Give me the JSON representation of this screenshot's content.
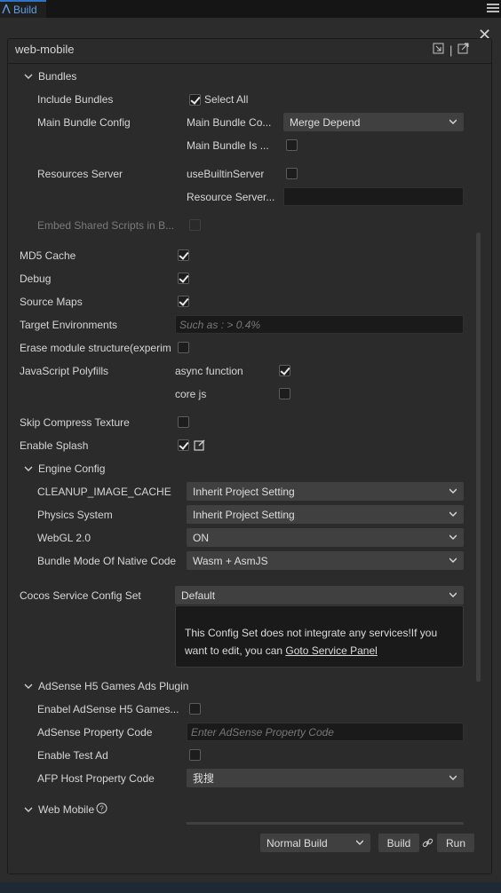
{
  "tab": {
    "label": "Build"
  },
  "panel": {
    "title": "web-mobile",
    "header_separator": "|"
  },
  "bundles": {
    "section_label": "Bundles",
    "include_bundles_label": "Include Bundles",
    "select_all_label": "Select All",
    "select_all_checked": true,
    "main_bundle_config_label": "Main Bundle Config",
    "main_bundle_compression_label": "Main Bundle Co...",
    "main_bundle_compression_value": "Merge Depend",
    "main_bundle_is_remote_label": "Main Bundle Is ...",
    "main_bundle_is_remote_checked": false,
    "resources_server_label": "Resources Server",
    "use_builtin_server_label": "useBuiltinServer",
    "use_builtin_server_checked": false,
    "resource_server_address_label": "Resource Server...",
    "resource_server_address_value": "",
    "embed_shared_scripts_label": "Embed Shared Scripts in B..."
  },
  "options": {
    "md5_cache_label": "MD5 Cache",
    "debug_label": "Debug",
    "source_maps_label": "Source Maps",
    "target_env_label": "Target Environments",
    "target_env_placeholder": "Such as : > 0.4%",
    "erase_module_label": "Erase module structure(experim",
    "js_polyfills_label": "JavaScript Polyfills",
    "async_function_label": "async function",
    "core_js_label": "core js",
    "skip_compress_label": "Skip Compress Texture",
    "enable_splash_label": "Enable Splash"
  },
  "engine_config": {
    "section_label": "Engine Config",
    "rows": [
      {
        "label": "CLEANUP_IMAGE_CACHE",
        "value": "Inherit Project Setting"
      },
      {
        "label": "Physics System",
        "value": "Inherit Project Setting"
      },
      {
        "label": "WebGL 2.0",
        "value": "ON"
      },
      {
        "label": "Bundle Mode Of Native Code",
        "value": "Wasm + AsmJS"
      }
    ]
  },
  "cocos_service": {
    "label": "Cocos Service Config Set",
    "value": "Default",
    "notice_text": "This Config Set does not integrate any services!If you want to edit, you can ",
    "notice_link": "Goto Service Panel"
  },
  "adsense": {
    "section_label": "AdSense H5 Games Ads Plugin",
    "enable_label": "Enabel AdSense H5 Games...",
    "property_code_label": "AdSense Property Code",
    "property_code_placeholder": "Enter AdSense Property Code",
    "test_ad_label": "Enable Test Ad",
    "afp_host_label": "AFP Host Property Code",
    "afp_host_value": "我搜"
  },
  "web_mobile": {
    "section_label": "Web Mobile"
  },
  "footer": {
    "build_type_value": "Normal Build",
    "build_button": "Build",
    "run_button": "Run"
  },
  "colors": {
    "accent": "#2d74c9",
    "panel_bg": "#2c2c2c",
    "field_bg": "#404040",
    "input_bg": "#1a1a1a"
  }
}
